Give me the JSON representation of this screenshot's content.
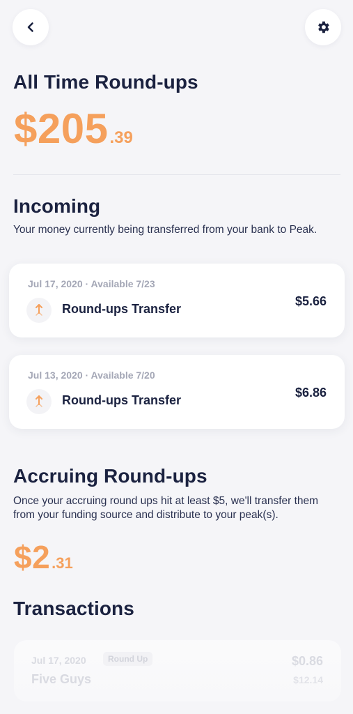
{
  "header": {
    "back_icon": "chevron-left-icon",
    "settings_icon": "gear-icon"
  },
  "all_time": {
    "title": "All Time Round-ups",
    "amount_main": "$205",
    "amount_cents": ".39"
  },
  "incoming": {
    "title": "Incoming",
    "description": "Your money currently being transferred from your bank to Peak.",
    "transfers": [
      {
        "meta": "Jul 17, 2020 · Available 7/23",
        "title": "Round-ups Transfer",
        "amount": "$5.66"
      },
      {
        "meta": "Jul 13, 2020 · Available 7/20",
        "title": "Round-ups Transfer",
        "amount": "$6.86"
      }
    ]
  },
  "accruing": {
    "title": "Accruing Round-ups",
    "description": "Once your accruing round ups hit at least $5, we'll transfer them from your funding source and distribute to your peak(s).",
    "amount_main": "$2",
    "amount_cents": ".31"
  },
  "transactions": {
    "title": "Transactions",
    "items": [
      {
        "date": "Jul 17, 2020",
        "badge": "Round Up",
        "merchant": "Five Guys",
        "roundup": "$0.86",
        "total": "$12.14"
      }
    ]
  },
  "colors": {
    "accent": "#f5a05c",
    "navy": "#1b2240",
    "background": "#f5f5f8"
  }
}
